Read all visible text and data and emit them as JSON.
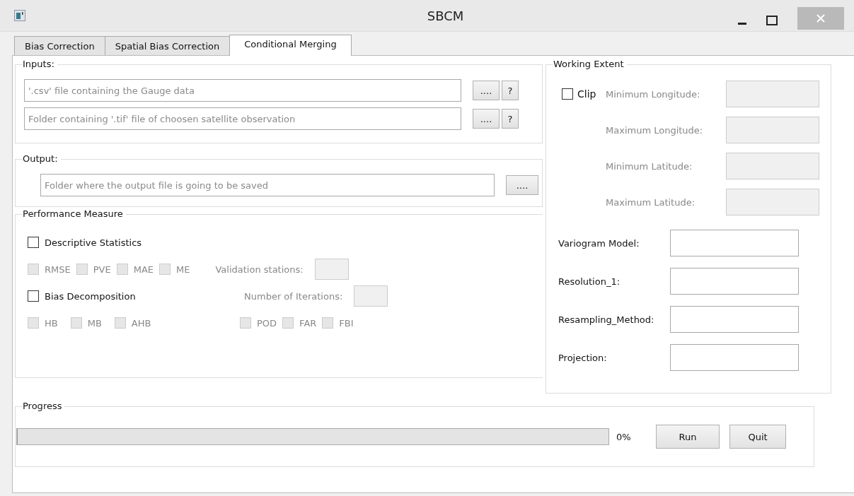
{
  "window": {
    "title": "SBCM"
  },
  "tabs": [
    {
      "label": "Bias Correction",
      "selected": false
    },
    {
      "label": "Spatial Bias Correction",
      "selected": false
    },
    {
      "label": "Conditional Merging",
      "selected": true
    }
  ],
  "inputs": {
    "title": "Inputs:",
    "fields": [
      {
        "placeholder": "'.csv' file containing the Gauge data",
        "browse": "....",
        "help": "?"
      },
      {
        "placeholder": "Folder containing '.tif' file of choosen satellite observation",
        "browse": "....",
        "help": "?"
      }
    ]
  },
  "output": {
    "title": "Output:",
    "placeholder": "Folder where the output file is going to be saved",
    "browse": "...."
  },
  "performance": {
    "title": "Performance Measure",
    "descriptive": {
      "label": "Descriptive Statistics",
      "checked": false
    },
    "metrics": [
      {
        "label": "RMSE",
        "checked": false,
        "disabled": true
      },
      {
        "label": "PVE",
        "checked": false,
        "disabled": true
      },
      {
        "label": "MAE",
        "checked": false,
        "disabled": true
      },
      {
        "label": "ME",
        "checked": false,
        "disabled": true
      }
    ],
    "validation": {
      "label": "Validation stations:",
      "disabled": true
    },
    "bias": {
      "label": "Bias Decomposition",
      "checked": false
    },
    "iterations": {
      "label": "Number of Iterations:",
      "disabled": true
    },
    "bias_metrics": [
      {
        "label": "HB",
        "checked": false,
        "disabled": true
      },
      {
        "label": "MB",
        "checked": false,
        "disabled": true
      },
      {
        "label": "AHB",
        "checked": false,
        "disabled": true
      }
    ],
    "contingency": [
      {
        "label": "POD",
        "checked": false,
        "disabled": true
      },
      {
        "label": "FAR",
        "checked": false,
        "disabled": true
      },
      {
        "label": "FBI",
        "checked": false,
        "disabled": true
      }
    ]
  },
  "extent": {
    "title": "Working Extent",
    "clip": {
      "label": "Clip",
      "checked": false
    },
    "bounds": [
      {
        "label": "Minimum Longitude:",
        "disabled": true
      },
      {
        "label": "Maximum Longitude:",
        "disabled": true
      },
      {
        "label": "Minimum Latitude:",
        "disabled": true
      },
      {
        "label": "Maximum Latitude:",
        "disabled": true
      }
    ],
    "params": [
      {
        "label": "Variogram Model:"
      },
      {
        "label": "Resolution_1:"
      },
      {
        "label": "Resampling_Method:"
      },
      {
        "label": "Projection:"
      }
    ]
  },
  "progress": {
    "title": "Progress",
    "level": 0,
    "reading": "0%"
  },
  "buttons": [
    {
      "label": "Run"
    },
    {
      "label": "Quit"
    }
  ]
}
